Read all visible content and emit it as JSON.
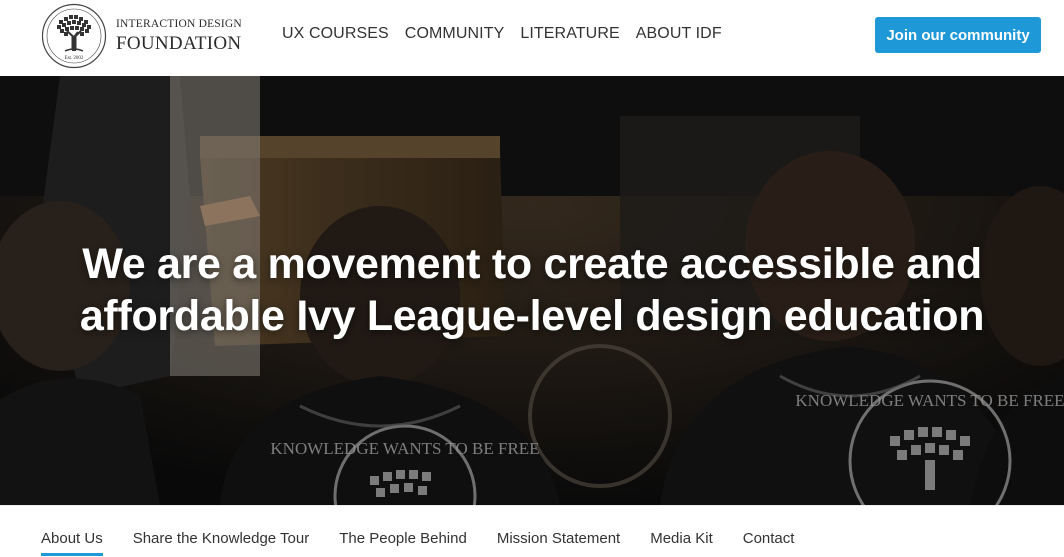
{
  "logo": {
    "line1": "INTERACTION DESIGN",
    "line2": "FOUNDATION",
    "seal_est": "Est. 2002"
  },
  "nav": {
    "items": [
      {
        "label": "UX COURSES"
      },
      {
        "label": "COMMUNITY"
      },
      {
        "label": "LITERATURE"
      },
      {
        "label": "ABOUT IDF"
      }
    ]
  },
  "join_button": {
    "label": "Join our community"
  },
  "hero": {
    "title_line1": "We are a movement to create accessible and",
    "title_line2": "affordable Ivy League-level design education",
    "shirt_text": "KNOWLEDGE WANTS TO BE FREE"
  },
  "subnav": {
    "items": [
      {
        "label": "About Us",
        "active": true
      },
      {
        "label": "Share the Knowledge Tour",
        "active": false
      },
      {
        "label": "The People Behind",
        "active": false
      },
      {
        "label": "Mission Statement",
        "active": false
      },
      {
        "label": "Media Kit",
        "active": false
      },
      {
        "label": "Contact",
        "active": false
      }
    ]
  },
  "colors": {
    "accent": "#1f98d8",
    "nav_text": "#333333",
    "hero_text": "#ffffff"
  }
}
